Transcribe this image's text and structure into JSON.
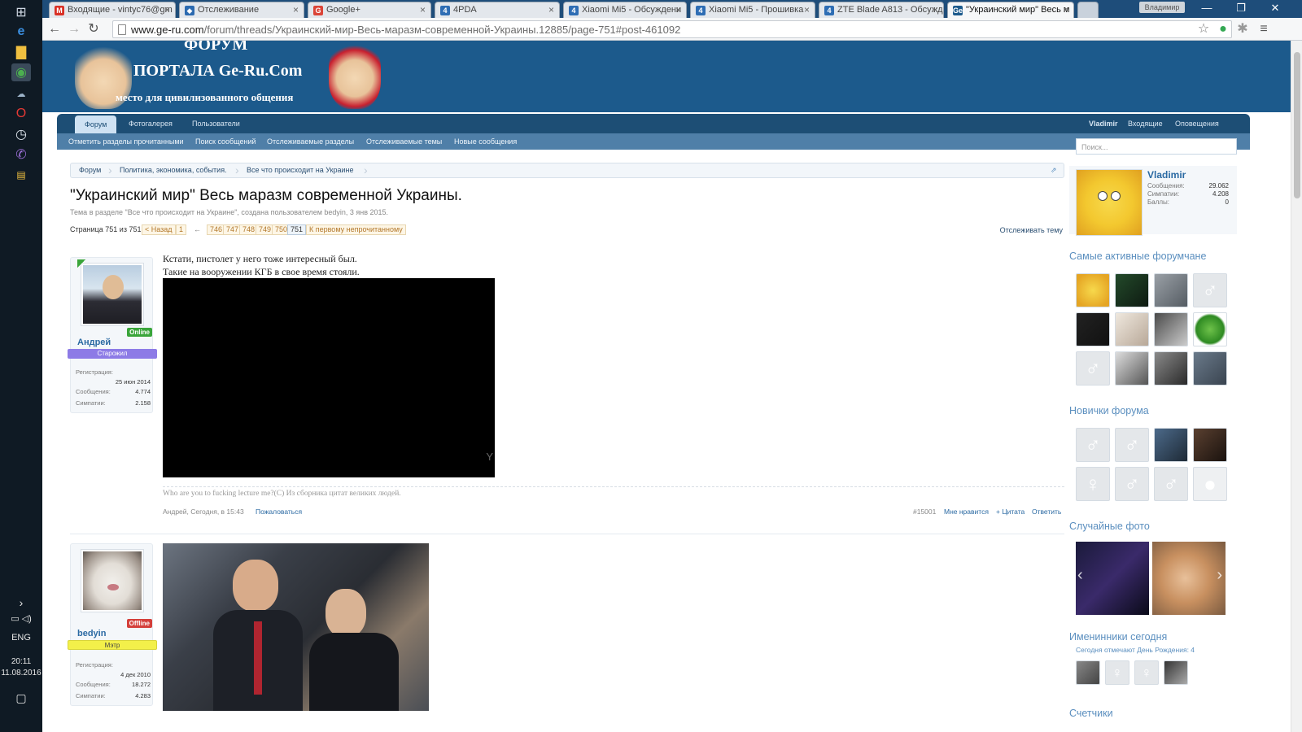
{
  "browser": {
    "tabs": [
      {
        "label": "Входящие - vintyc76@gm",
        "fav": "M",
        "fav_color": "#d93025"
      },
      {
        "label": "Отслеживание",
        "fav": "◆",
        "fav_color": "#2b6ab0"
      },
      {
        "label": "Google+",
        "fav": "G",
        "fav_color": "#db4437"
      },
      {
        "label": "4PDA",
        "fav": "4",
        "fav_color": "#2e6db4"
      },
      {
        "label": "Xiaomi Mi5 - Обсуждени",
        "fav": "4",
        "fav_color": "#2e6db4"
      },
      {
        "label": "Xiaomi Mi5 - Прошивка",
        "fav": "4",
        "fav_color": "#2e6db4"
      },
      {
        "label": "ZTE Blade A813 - Обсужд",
        "fav": "4",
        "fav_color": "#2e6db4"
      },
      {
        "label": "\"Украинский мир\" Весь м",
        "fav": "Ge",
        "fav_color": "#1c5a8c"
      }
    ],
    "user_badge": "Владимир",
    "url_domain": "www.ge-ru.com",
    "url_path": "/forum/threads/Украинский-мир-Весь-маразм-современной-Украины.12885/page-751#post-461092"
  },
  "taskbar": {
    "lang": "ENG",
    "time": "20:11",
    "date": "11.08.2016"
  },
  "header": {
    "line1": "ФОРУМ",
    "line2": "ПОРТАЛА Ge-Ru.Com",
    "line3": "место для цивилизованного общения"
  },
  "nav": {
    "tabs": [
      "Форум",
      "Фотогалерея",
      "Пользователи"
    ],
    "right": [
      "Vladimir",
      "Входящие",
      "Оповещения"
    ],
    "sub": [
      "Отметить разделы прочитанными",
      "Поиск сообщений",
      "Отслеживаемые разделы",
      "Отслеживаемые темы",
      "Новые сообщения"
    ],
    "search_placeholder": "Поиск..."
  },
  "breadcrumb": [
    "Форум",
    "Политика, экономика, события.",
    "Все что происходит на Украине"
  ],
  "thread": {
    "title": "\"Украинский мир\" Весь маразм современной Украины.",
    "meta": "Тема в разделе \"Все что происходит на Украине\", создана пользователем bedyin, 3 янв 2015.",
    "page_info": "Страница 751 из 751",
    "prev": "< Назад",
    "first": "1",
    "ellipsis": "←",
    "pages": [
      "746",
      "747",
      "748",
      "749",
      "750",
      "751"
    ],
    "first_unread": "К первому непрочитанному",
    "watch": "Отслеживать тему"
  },
  "posts": [
    {
      "username": "Андрей",
      "status": "Online",
      "rank": "Старожил",
      "stats": [
        {
          "k": "Регистрация:",
          "v": ""
        },
        {
          "k": "",
          "v": "25 июн 2014"
        },
        {
          "k": "Сообщения:",
          "v": "4.774"
        },
        {
          "k": "Симпатии:",
          "v": "2.158"
        }
      ],
      "text1": "Кстати, пистолет у него тоже интересный был.",
      "text2": "Такие на вооружении КГБ в свое время стояли.",
      "signature": "Who are you to fucking lecture me?(C) Из сборника цитат великих людей.",
      "byline": "Андрей, Сегодня, в 15:43",
      "report": "Пожаловаться",
      "num": "#15001",
      "like": "Мне нравится",
      "quote": "+ Цитата",
      "reply": "Ответить"
    },
    {
      "username": "bedyin",
      "status": "Offline",
      "rank": "Мэтр",
      "stats": [
        {
          "k": "Регистрация:",
          "v": ""
        },
        {
          "k": "",
          "v": "4 дек 2010"
        },
        {
          "k": "Сообщения:",
          "v": "18.272"
        },
        {
          "k": "Симпатии:",
          "v": "4.283"
        }
      ]
    }
  ],
  "sidebar": {
    "me_name": "Vladimir",
    "me_stats": [
      {
        "k": "Сообщения:",
        "v": "29.062"
      },
      {
        "k": "Симпатии:",
        "v": "4.208"
      },
      {
        "k": "Баллы:",
        "v": "0"
      }
    ],
    "active_title": "Самые активные форумчане",
    "newbies_title": "Новички форума",
    "photos_title": "Случайные фото",
    "bday_title": "Именинники сегодня",
    "bday_text": "Сегодня отмечают День Рождения: 4",
    "counters_title": "Счетчики"
  },
  "colors": {
    "header_blue": "#1c5a8c",
    "nav_dark": "#1d4e75",
    "online": "#3aa53a",
    "offline": "#d43f3a",
    "rank_old": "#8d7be6",
    "rank_master": "#f3f04a"
  }
}
